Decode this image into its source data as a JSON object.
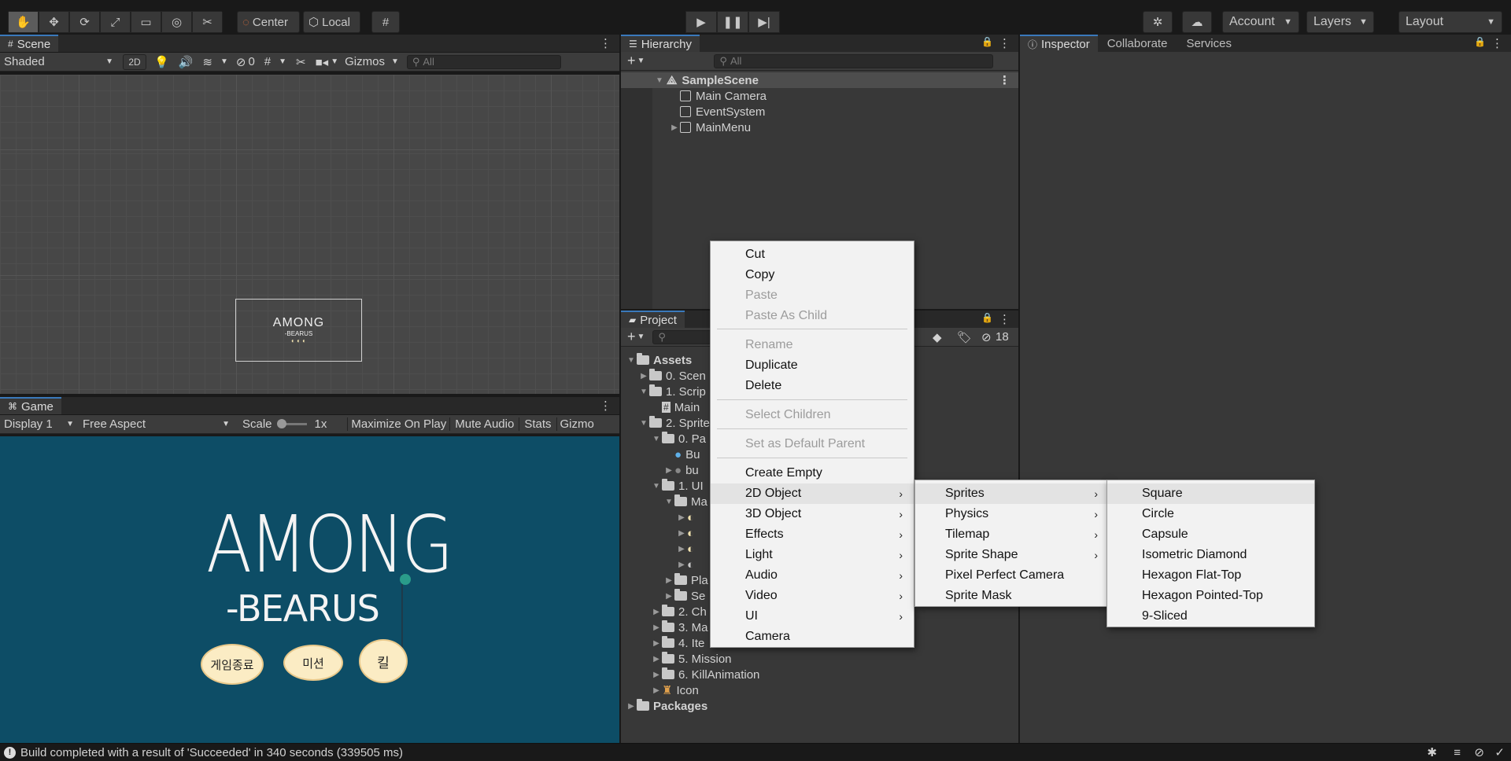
{
  "toolbar": {
    "pivot_label": "Center",
    "space_label": "Local",
    "account_label": "Account",
    "layers_label": "Layers",
    "layout_label": "Layout"
  },
  "scene": {
    "tab_label": "Scene",
    "shading_mode": "Shaded",
    "mode_2d": "2D",
    "hidden_count": "0",
    "gizmos_label": "Gizmos",
    "search_placeholder": "All"
  },
  "game": {
    "tab_label": "Game",
    "display_label": "Display 1",
    "aspect_label": "Free Aspect",
    "scale_label": "Scale",
    "scale_value": "1x",
    "maximize_label": "Maximize On Play",
    "mute_label": "Mute Audio",
    "stats_label": "Stats",
    "gizmos_label": "Gizmo",
    "logo_title": "AMONG",
    "logo_subtitle": "-BEARUS",
    "fish_buttons": [
      "게임종료",
      "미션",
      "킬"
    ]
  },
  "hierarchy": {
    "tab_label": "Hierarchy",
    "search_placeholder": "All",
    "scene_name": "SampleScene",
    "items": [
      "Main Camera",
      "EventSystem",
      "MainMenu"
    ]
  },
  "project": {
    "tab_label": "Project",
    "hidden_count": "18",
    "tree": [
      {
        "label": "Assets"
      },
      {
        "label": "0. Scen"
      },
      {
        "label": "1. Scrip"
      },
      {
        "label": "Main"
      },
      {
        "label": "2. Sprite"
      },
      {
        "label": "0. Pa"
      },
      {
        "label": "Bu"
      },
      {
        "label": "bu"
      },
      {
        "label": "1. UI"
      },
      {
        "label": "Ma"
      },
      {
        "label": "Pla"
      },
      {
        "label": "Se"
      },
      {
        "label": "2. Ch"
      },
      {
        "label": "3. Ma"
      },
      {
        "label": "4. Ite"
      },
      {
        "label": "5. Mission"
      },
      {
        "label": "6. KillAnimation"
      },
      {
        "label": "Icon"
      },
      {
        "label": "Packages"
      }
    ]
  },
  "inspector": {
    "tabs": [
      "Inspector",
      "Collaborate",
      "Services"
    ]
  },
  "context_menu": {
    "items": [
      {
        "label": "Cut"
      },
      {
        "label": "Copy"
      },
      {
        "label": "Paste"
      },
      {
        "label": "Paste As Child"
      },
      {
        "label": "Rename"
      },
      {
        "label": "Duplicate"
      },
      {
        "label": "Delete"
      },
      {
        "label": "Select Children"
      },
      {
        "label": "Set as Default Parent"
      },
      {
        "label": "Create Empty"
      },
      {
        "label": "2D Object"
      },
      {
        "label": "3D Object"
      },
      {
        "label": "Effects"
      },
      {
        "label": "Light"
      },
      {
        "label": "Audio"
      },
      {
        "label": "Video"
      },
      {
        "label": "UI"
      },
      {
        "label": "Camera"
      }
    ]
  },
  "submenu_2d": {
    "items": [
      "Sprites",
      "Physics",
      "Tilemap",
      "Sprite Shape",
      "Pixel Perfect Camera",
      "Sprite Mask"
    ]
  },
  "submenu_sprites": {
    "items": [
      "Square",
      "Circle",
      "Capsule",
      "Isometric Diamond",
      "Hexagon Flat-Top",
      "Hexagon Pointed-Top",
      "9-Sliced"
    ]
  },
  "status": {
    "message": "Build completed with a result of 'Succeeded' in 340 seconds (339505 ms)"
  }
}
